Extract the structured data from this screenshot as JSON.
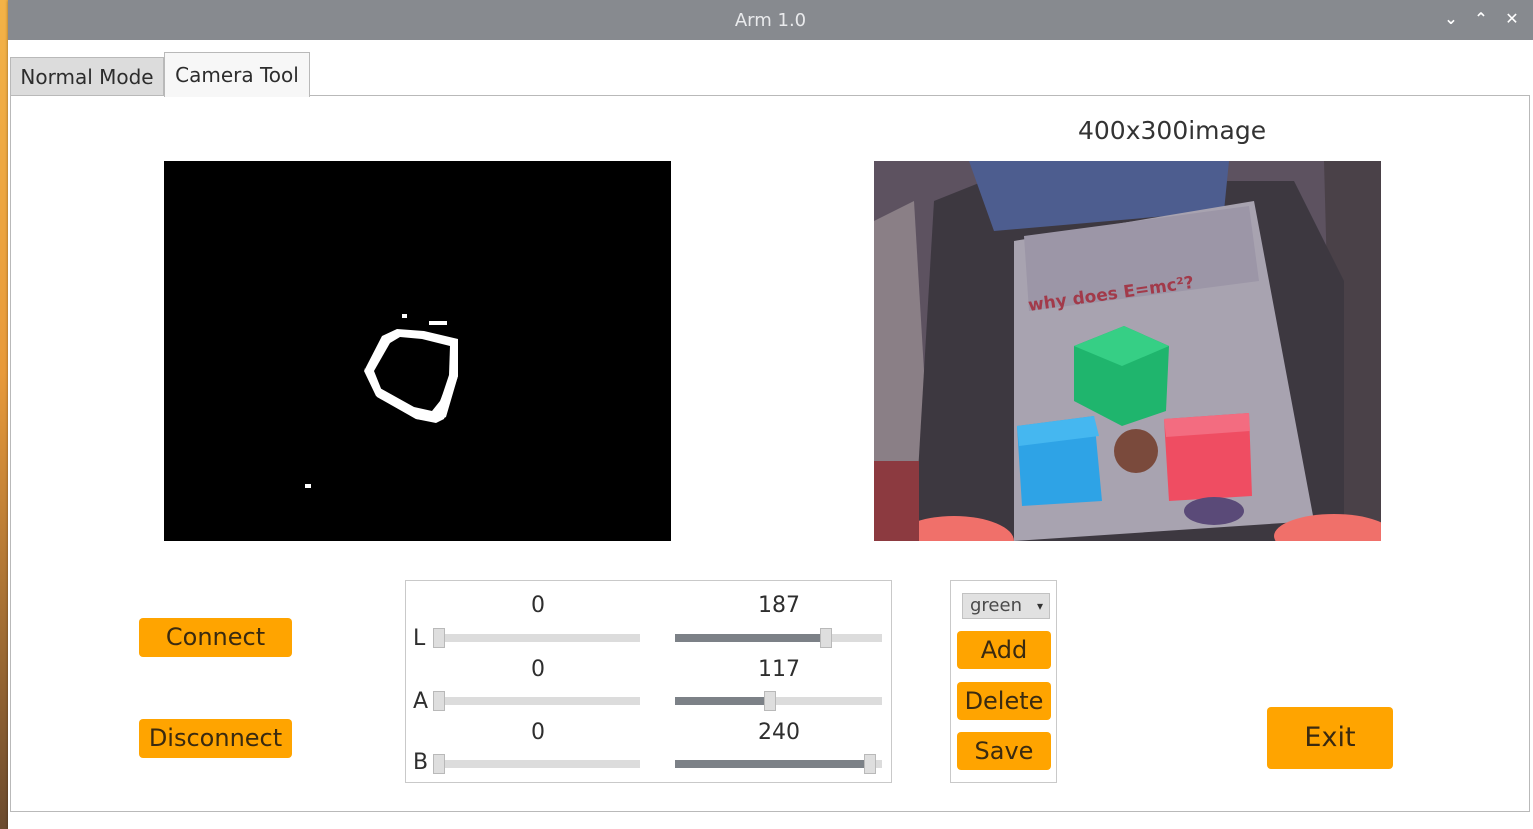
{
  "window": {
    "title": "Arm 1.0",
    "controls": [
      "⌄",
      "⌃",
      "✕"
    ]
  },
  "tabs": [
    {
      "label": "Normal Mode",
      "active": false
    },
    {
      "label": "Camera Tool",
      "active": true
    }
  ],
  "views": {
    "image_caption": "400x300image"
  },
  "buttons": {
    "connect": "Connect",
    "disconnect": "Disconnect",
    "exit": "Exit"
  },
  "sliders": [
    {
      "channel": "L",
      "min_value": "0",
      "max_value": "187",
      "min_fraction": 0.0,
      "max_fraction": 0.73
    },
    {
      "channel": "A",
      "min_value": "0",
      "max_value": "117",
      "min_fraction": 0.0,
      "max_fraction": 0.46
    },
    {
      "channel": "B",
      "min_value": "0",
      "max_value": "240",
      "min_fraction": 0.0,
      "max_fraction": 0.94
    }
  ],
  "color_panel": {
    "selected": "green",
    "add": "Add",
    "delete": "Delete",
    "save": "Save"
  },
  "camera_scene_text": "why does E=mc²?",
  "colors": {
    "accent": "#ffa400",
    "titlebar": "#878a8f"
  }
}
